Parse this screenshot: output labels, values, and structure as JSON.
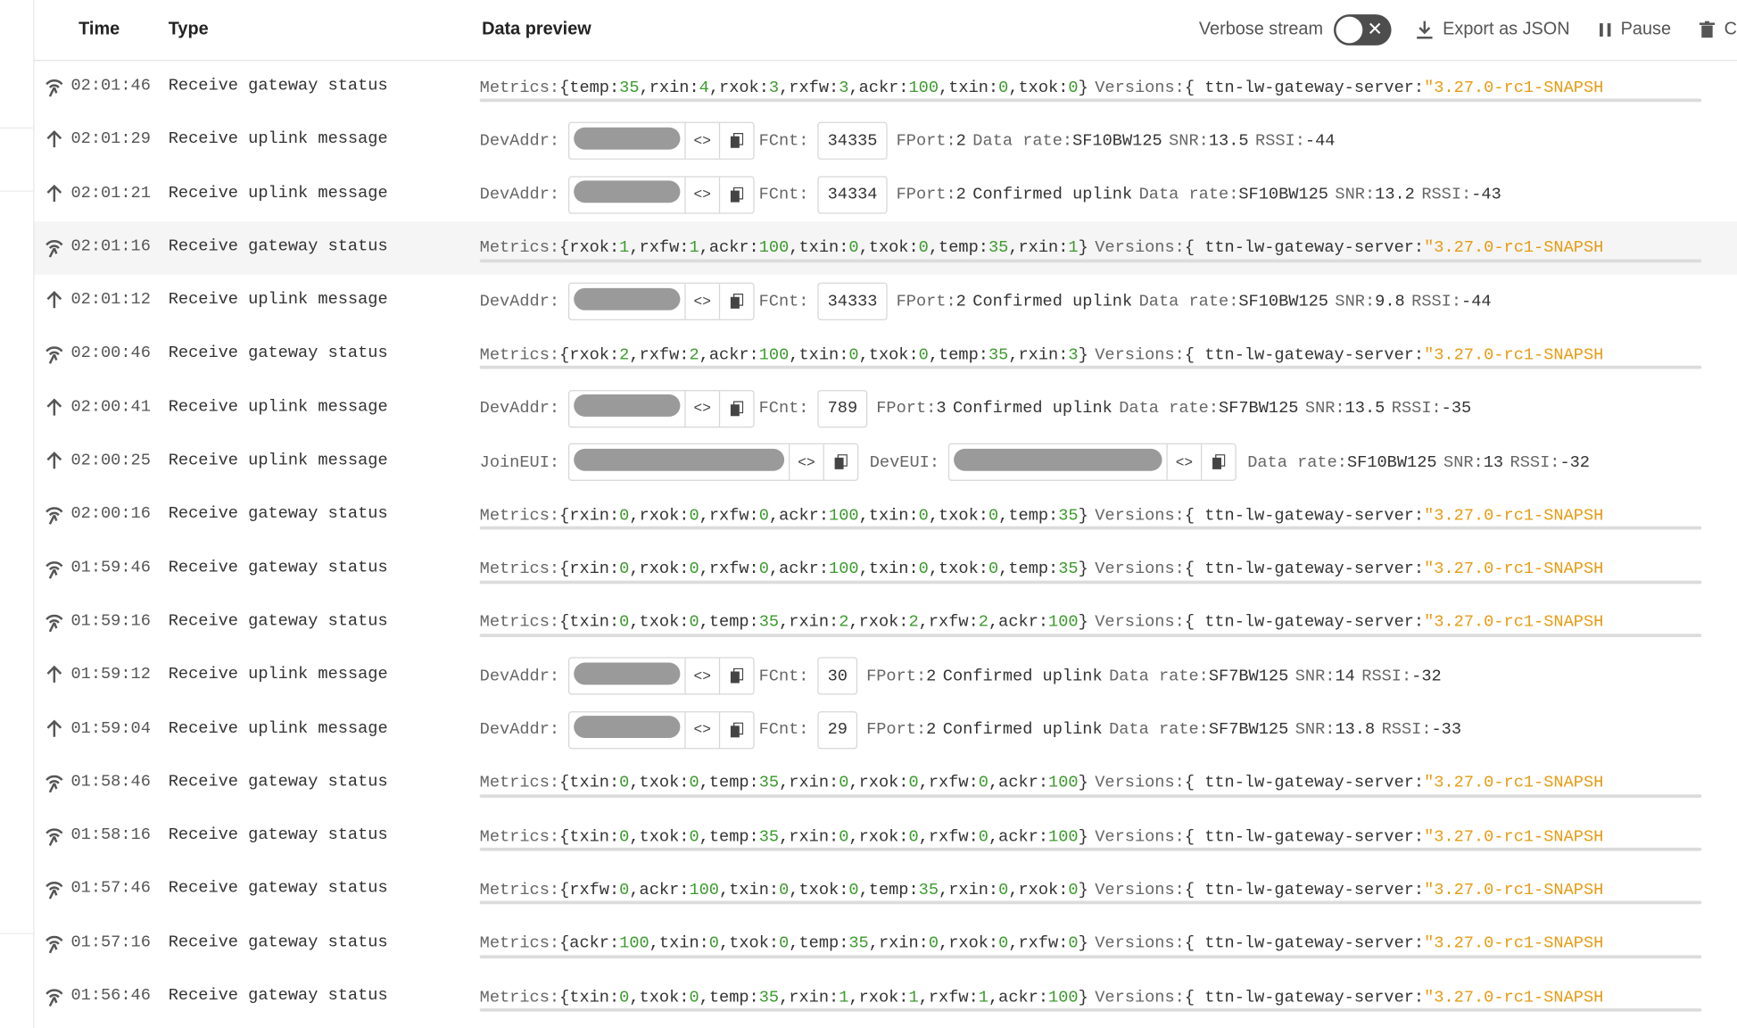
{
  "header": {
    "col_time": "Time",
    "col_type": "Type",
    "col_preview": "Data preview",
    "verbose_label": "Verbose stream",
    "export_label": "Export as JSON",
    "pause_label": "Pause",
    "clear_label": "C"
  },
  "labels": {
    "metrics": "Metrics:",
    "versions": "Versions:",
    "server_key": "ttn-lw-gateway-server:",
    "server_val": "\"3.27.0-rc1-SNAPSH",
    "devaddr": "DevAddr:",
    "joineui": "JoinEUI:",
    "deveui": "DevEUI:",
    "fcnt": "FCnt:",
    "fport": "FPort:",
    "confirmed": "Confirmed uplink",
    "data_rate": "Data rate:",
    "snr": "SNR:",
    "rssi": "RSSI:"
  },
  "rows": [
    {
      "kind": "gateway",
      "time": "02:01:46",
      "type": "Receive gateway status",
      "metrics": [
        [
          "temp",
          "35"
        ],
        [
          "rxin",
          "4"
        ],
        [
          "rxok",
          "3"
        ],
        [
          "rxfw",
          "3"
        ],
        [
          "ackr",
          "100"
        ],
        [
          "txin",
          "0"
        ],
        [
          "txok",
          "0"
        ]
      ]
    },
    {
      "kind": "uplink",
      "time": "02:01:29",
      "type": "Receive uplink message",
      "fcnt": "34335",
      "fport": "2",
      "confirmed": false,
      "rate": "SF10BW125",
      "snr": "13.5",
      "rssi": "-44"
    },
    {
      "kind": "uplink",
      "time": "02:01:21",
      "type": "Receive uplink message",
      "fcnt": "34334",
      "fport": "2",
      "confirmed": true,
      "rate": "SF10BW125",
      "snr": "13.2",
      "rssi": "-43"
    },
    {
      "kind": "gateway",
      "time": "02:01:16",
      "type": "Receive gateway status",
      "highlight": true,
      "metrics": [
        [
          "rxok",
          "1"
        ],
        [
          "rxfw",
          "1"
        ],
        [
          "ackr",
          "100"
        ],
        [
          "txin",
          "0"
        ],
        [
          "txok",
          "0"
        ],
        [
          "temp",
          "35"
        ],
        [
          "rxin",
          "1"
        ]
      ]
    },
    {
      "kind": "uplink",
      "time": "02:01:12",
      "type": "Receive uplink message",
      "fcnt": "34333",
      "fport": "2",
      "confirmed": true,
      "rate": "SF10BW125",
      "snr": "9.8",
      "rssi": "-44"
    },
    {
      "kind": "gateway",
      "time": "02:00:46",
      "type": "Receive gateway status",
      "metrics": [
        [
          "rxok",
          "2"
        ],
        [
          "rxfw",
          "2"
        ],
        [
          "ackr",
          "100"
        ],
        [
          "txin",
          "0"
        ],
        [
          "txok",
          "0"
        ],
        [
          "temp",
          "35"
        ],
        [
          "rxin",
          "3"
        ]
      ]
    },
    {
      "kind": "uplink",
      "time": "02:00:41",
      "type": "Receive uplink message",
      "fcnt": "789",
      "fport": "3",
      "confirmed": true,
      "rate": "SF7BW125",
      "snr": "13.5",
      "rssi": "-35"
    },
    {
      "kind": "join",
      "time": "02:00:25",
      "type": "Receive uplink message",
      "rate": "SF10BW125",
      "snr": "13",
      "rssi": "-32"
    },
    {
      "kind": "gateway",
      "time": "02:00:16",
      "type": "Receive gateway status",
      "metrics": [
        [
          "rxin",
          "0"
        ],
        [
          "rxok",
          "0"
        ],
        [
          "rxfw",
          "0"
        ],
        [
          "ackr",
          "100"
        ],
        [
          "txin",
          "0"
        ],
        [
          "txok",
          "0"
        ],
        [
          "temp",
          "35"
        ]
      ]
    },
    {
      "kind": "gateway",
      "time": "01:59:46",
      "type": "Receive gateway status",
      "metrics": [
        [
          "rxin",
          "0"
        ],
        [
          "rxok",
          "0"
        ],
        [
          "rxfw",
          "0"
        ],
        [
          "ackr",
          "100"
        ],
        [
          "txin",
          "0"
        ],
        [
          "txok",
          "0"
        ],
        [
          "temp",
          "35"
        ]
      ]
    },
    {
      "kind": "gateway",
      "time": "01:59:16",
      "type": "Receive gateway status",
      "metrics": [
        [
          "txin",
          "0"
        ],
        [
          "txok",
          "0"
        ],
        [
          "temp",
          "35"
        ],
        [
          "rxin",
          "2"
        ],
        [
          "rxok",
          "2"
        ],
        [
          "rxfw",
          "2"
        ],
        [
          "ackr",
          "100"
        ]
      ]
    },
    {
      "kind": "uplink",
      "time": "01:59:12",
      "type": "Receive uplink message",
      "fcnt": "30",
      "fport": "2",
      "confirmed": true,
      "rate": "SF7BW125",
      "snr": "14",
      "rssi": "-32"
    },
    {
      "kind": "uplink",
      "time": "01:59:04",
      "type": "Receive uplink message",
      "fcnt": "29",
      "fport": "2",
      "confirmed": true,
      "rate": "SF7BW125",
      "snr": "13.8",
      "rssi": "-33"
    },
    {
      "kind": "gateway",
      "time": "01:58:46",
      "type": "Receive gateway status",
      "metrics": [
        [
          "txin",
          "0"
        ],
        [
          "txok",
          "0"
        ],
        [
          "temp",
          "35"
        ],
        [
          "rxin",
          "0"
        ],
        [
          "rxok",
          "0"
        ],
        [
          "rxfw",
          "0"
        ],
        [
          "ackr",
          "100"
        ]
      ]
    },
    {
      "kind": "gateway",
      "time": "01:58:16",
      "type": "Receive gateway status",
      "metrics": [
        [
          "txin",
          "0"
        ],
        [
          "txok",
          "0"
        ],
        [
          "temp",
          "35"
        ],
        [
          "rxin",
          "0"
        ],
        [
          "rxok",
          "0"
        ],
        [
          "rxfw",
          "0"
        ],
        [
          "ackr",
          "100"
        ]
      ]
    },
    {
      "kind": "gateway",
      "time": "01:57:46",
      "type": "Receive gateway status",
      "metrics": [
        [
          "rxfw",
          "0"
        ],
        [
          "ackr",
          "100"
        ],
        [
          "txin",
          "0"
        ],
        [
          "txok",
          "0"
        ],
        [
          "temp",
          "35"
        ],
        [
          "rxin",
          "0"
        ],
        [
          "rxok",
          "0"
        ]
      ]
    },
    {
      "kind": "gateway",
      "time": "01:57:16",
      "type": "Receive gateway status",
      "metrics": [
        [
          "ackr",
          "100"
        ],
        [
          "txin",
          "0"
        ],
        [
          "txok",
          "0"
        ],
        [
          "temp",
          "35"
        ],
        [
          "rxin",
          "0"
        ],
        [
          "rxok",
          "0"
        ],
        [
          "rxfw",
          "0"
        ]
      ]
    },
    {
      "kind": "gateway",
      "time": "01:56:46",
      "type": "Receive gateway status",
      "metrics": [
        [
          "txin",
          "0"
        ],
        [
          "txok",
          "0"
        ],
        [
          "temp",
          "35"
        ],
        [
          "rxin",
          "1"
        ],
        [
          "rxok",
          "1"
        ],
        [
          "rxfw",
          "1"
        ],
        [
          "ackr",
          "100"
        ]
      ]
    }
  ]
}
